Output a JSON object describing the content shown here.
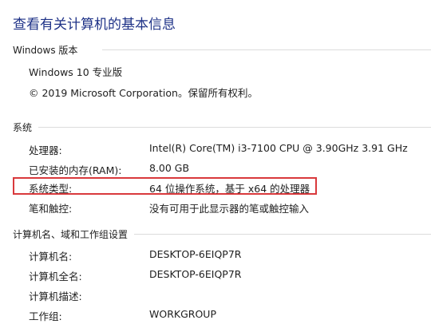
{
  "page_title": "查看有关计算机的基本信息",
  "windows_edition": {
    "heading": "Windows 版本",
    "edition": "Windows 10 专业版",
    "copyright": "© 2019 Microsoft Corporation。保留所有权利。"
  },
  "system": {
    "heading": "系统",
    "rows": [
      {
        "label": "处理器:",
        "value": "Intel(R) Core(TM) i3-7100 CPU @ 3.90GHz   3.91 GHz"
      },
      {
        "label": "已安装的内存(RAM):",
        "value": "8.00 GB"
      },
      {
        "label": "系统类型:",
        "value": "64 位操作系统，基于 x64 的处理器"
      },
      {
        "label": "笔和触控:",
        "value": "没有可用于此显示器的笔或触控输入"
      }
    ]
  },
  "computer_name": {
    "heading": "计算机名、域和工作组设置",
    "rows": [
      {
        "label": "计算机名:",
        "value": "DESKTOP-6EIQP7R"
      },
      {
        "label": "计算机全名:",
        "value": "DESKTOP-6EIQP7R"
      },
      {
        "label": "计算机描述:",
        "value": ""
      },
      {
        "label": "工作组:",
        "value": "WORKGROUP"
      }
    ]
  },
  "colors": {
    "title": "#1e3287",
    "highlight_border": "#d9393c"
  }
}
